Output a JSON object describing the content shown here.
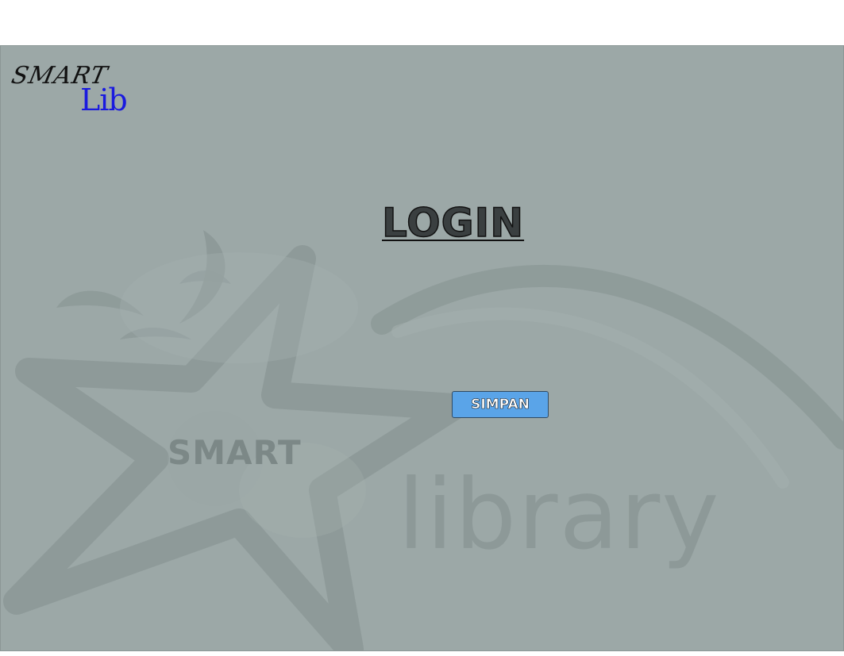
{
  "logo": {
    "word_top": "SMART",
    "word_bottom": "Lib"
  },
  "title": "LOGIN",
  "actions": {
    "simpan_label": "SIMPAN"
  },
  "watermark": {
    "smart": "SMART",
    "library": "library"
  },
  "colors": {
    "background": "#9ca8a7",
    "button": "#5aa4e8",
    "logo_lib": "#1a1adf"
  },
  "icons": {
    "watermark": "star-logo"
  }
}
